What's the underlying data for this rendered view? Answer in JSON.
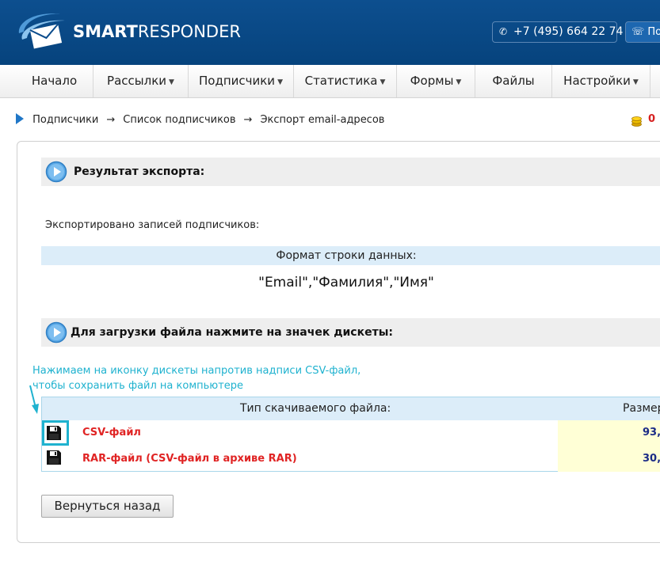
{
  "header": {
    "brand_bold": "SMART",
    "brand_light": "RESPONDER",
    "phone": "+7 (495) 664 22 74",
    "call_button": "По",
    "logo_icon": "envelope-swoosh-logo",
    "accent_color": "#0b4c8c"
  },
  "nav": {
    "items": [
      {
        "label": "Начало"
      },
      {
        "label": "Рассылки"
      },
      {
        "label": "Подписчики"
      },
      {
        "label": "Статистика"
      },
      {
        "label": "Формы"
      },
      {
        "label": "Файлы"
      },
      {
        "label": "Настройки"
      }
    ]
  },
  "breadcrumb": {
    "items": [
      "Подписчики",
      "Список подписчиков",
      "Экспорт email-адресов"
    ],
    "separator": "→"
  },
  "balance": {
    "value": "0"
  },
  "result_section": {
    "title": "Результат экспорта:",
    "exported_text": "Экспортировано записей подписчиков:",
    "format_header": "Формат строки данных:",
    "format_value": "\"Email\",\"Фамилия\",\"Имя\""
  },
  "download_section": {
    "title": "Для загрузки файла нажмите на значек дискеты:"
  },
  "annotation": {
    "line1": "Нажимаем на иконку дискеты напротив надписи CSV-файл,",
    "line2": "чтобы сохранить файл на компьютере",
    "color": "#1fb2cf"
  },
  "file_table": {
    "col_type": "Тип скачиваемого файла:",
    "col_size": "Размер",
    "rows": [
      {
        "name": "CSV-файл",
        "size": "93,"
      },
      {
        "name": "RAR-файл (CSV-файл в архиве RAR)",
        "size": "30,"
      }
    ]
  },
  "back_button": {
    "label": "Вернуться назад"
  }
}
